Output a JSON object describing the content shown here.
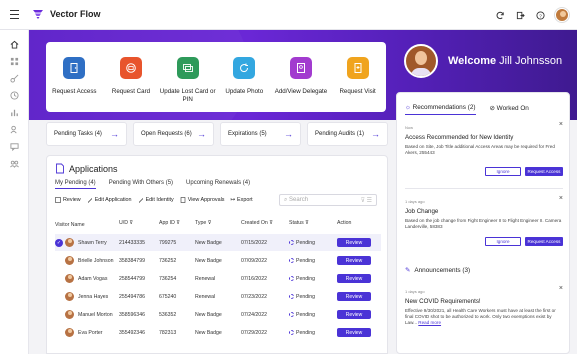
{
  "app": {
    "name": "Vector Flow"
  },
  "header": {
    "icons": [
      "refresh-icon",
      "logout-icon",
      "help-icon"
    ]
  },
  "sidebar": {
    "icons": [
      "home-icon",
      "apps-icon",
      "key-icon",
      "history-icon",
      "chart-icon",
      "users-icon",
      "chat-icon",
      "group-icon"
    ]
  },
  "quick_actions": [
    {
      "label": "Request Access",
      "icon": "door-icon",
      "color": "#2f6fc4"
    },
    {
      "label": "Request Card",
      "icon": "card-icon",
      "color": "#e8542c"
    },
    {
      "label": "Update Lost Card or PIN",
      "icon": "card-swap-icon",
      "color": "#2e9a5a"
    },
    {
      "label": "Update Photo",
      "icon": "photo-refresh-icon",
      "color": "#33a7e0"
    },
    {
      "label": "Add/View Delegate",
      "icon": "delegate-icon",
      "color": "#a23bcf"
    },
    {
      "label": "Request Visit",
      "icon": "visit-icon",
      "color": "#f0a41e"
    }
  ],
  "welcome": {
    "greeting": "Welcome",
    "name": "Jill Johnsson"
  },
  "summary_cards": [
    {
      "label": "Pending Tasks (4)"
    },
    {
      "label": "Open Requests (6)"
    },
    {
      "label": "Expirations (5)"
    },
    {
      "label": "Pending Audits (1)"
    }
  ],
  "applications": {
    "title": "Applications",
    "tabs": [
      "My Pending (4)",
      "Pending With Others (5)",
      "Upcoming Renewals (4)"
    ],
    "actions": [
      "Review",
      "Edit Application",
      "Edit Identity",
      "View Approvals",
      "Export"
    ],
    "search_placeholder": "Search",
    "columns": [
      "Visitor Name",
      "U/D",
      "App ID",
      "Type",
      "Created On",
      "Status",
      "Action"
    ],
    "rows": [
      {
        "name": "Shawn Terry",
        "uid": "214433335",
        "appid": "799275",
        "type": "New Badge",
        "created": "07/15/2022",
        "status": "Pending",
        "action": "Review",
        "selected": true
      },
      {
        "name": "Brielle Johnson",
        "uid": "358384799",
        "appid": "736252",
        "type": "New Badge",
        "created": "07/09/2022",
        "status": "Pending",
        "action": "Review",
        "selected": false
      },
      {
        "name": "Adam Vogas",
        "uid": "258544799",
        "appid": "736254",
        "type": "Renewal",
        "created": "07/16/2022",
        "status": "Pending",
        "action": "Review",
        "selected": false
      },
      {
        "name": "Jenna Hayes",
        "uid": "255494786",
        "appid": "675240",
        "type": "Renewal",
        "created": "07/23/2022",
        "status": "Pending",
        "action": "Review",
        "selected": false
      },
      {
        "name": "Manuel Morton",
        "uid": "358596346",
        "appid": "536352",
        "type": "New Badge",
        "created": "07/24/2022",
        "status": "Pending",
        "action": "Review",
        "selected": false
      },
      {
        "name": "Eva Porter",
        "uid": "355492346",
        "appid": "782313",
        "type": "New Badge",
        "created": "07/29/2022",
        "status": "Pending",
        "action": "Review",
        "selected": false
      }
    ]
  },
  "recommendations": {
    "tabs": [
      "Recommendations (2)",
      "Worked On"
    ],
    "items": [
      {
        "ago": "Now",
        "title": "Access Recommended for New Identity",
        "body": "Based on Site, Job Title additional Access Areas may be required for Fred Akers, 255443",
        "ignore": "Ignore",
        "request": "Request Access"
      },
      {
        "ago": "1 days ago",
        "title": "Job Change",
        "body": "Based on the job change from Fight Engineer II to Flight Engineer II. Camera Landerville, 58383",
        "ignore": "Ignore",
        "request": "Request Access"
      }
    ]
  },
  "announcements": {
    "title": "Announcements (3)",
    "item": {
      "ago": "1 days ago",
      "title": "New COVID Requirements!",
      "body": "Effective 9/30/2021, all Health Care Workers must have at least the first or final COVID shot to be authorized to work. Only two exemptions exist by Law...",
      "more": "Read more"
    }
  }
}
